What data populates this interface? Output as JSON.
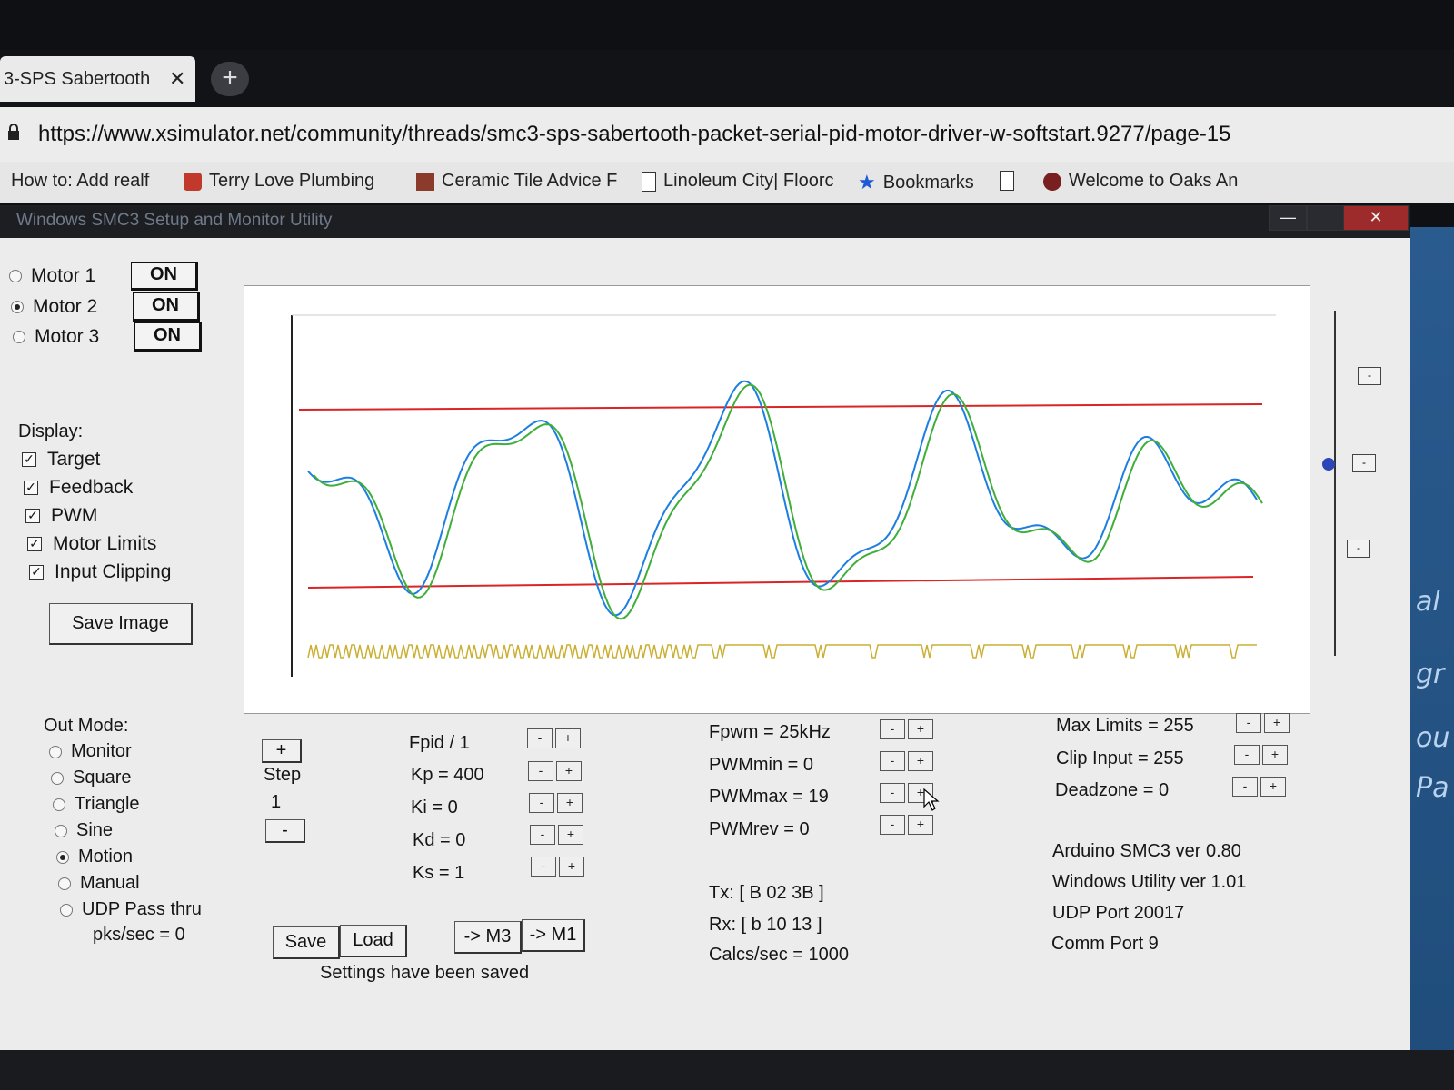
{
  "browser": {
    "tab_title": "3-SPS Sabertooth",
    "tab_close": "✕",
    "new_tab": "+",
    "url": "https://www.xsimulator.net/community/threads/smc3-sps-sabertooth-packet-serial-pid-motor-driver-w-softstart.9277/page-15",
    "bookmarks": [
      "How to: Add realf",
      "Terry Love Plumbing",
      "Ceramic Tile Advice F",
      "Linoleum City| Floorc",
      "Bookmarks",
      "Welcome to Oaks An"
    ]
  },
  "window": {
    "title": "Windows SMC3 Setup and Monitor Utility",
    "minimize": "—",
    "close": "✕"
  },
  "motors": [
    {
      "label": "Motor 1",
      "state": "ON",
      "selected": false
    },
    {
      "label": "Motor 2",
      "state": "ON",
      "selected": true
    },
    {
      "label": "Motor 3",
      "state": "ON",
      "selected": false
    }
  ],
  "display": {
    "heading": "Display:",
    "options": [
      {
        "label": "Target",
        "checked": true
      },
      {
        "label": "Feedback",
        "checked": true
      },
      {
        "label": "PWM",
        "checked": true
      },
      {
        "label": "Motor Limits",
        "checked": true
      },
      {
        "label": "Input Clipping",
        "checked": true
      }
    ],
    "save_image": "Save Image"
  },
  "out_mode": {
    "heading": "Out Mode:",
    "options": [
      {
        "label": "Monitor",
        "selected": false
      },
      {
        "label": "Square",
        "selected": false
      },
      {
        "label": "Triangle",
        "selected": false
      },
      {
        "label": "Sine",
        "selected": false
      },
      {
        "label": "Motion",
        "selected": true
      },
      {
        "label": "Manual",
        "selected": false
      },
      {
        "label": "UDP Pass thru",
        "selected": false
      }
    ],
    "pks": "pks/sec = 0"
  },
  "step": {
    "plus": "+",
    "label": "Step",
    "value": "1",
    "minus": "-"
  },
  "pid": {
    "fpid": "Fpid / 1",
    "kp": "Kp = 400",
    "ki": "Ki = 0",
    "kd": "Kd = 0",
    "ks": "Ks = 1"
  },
  "pwm": {
    "fpwm": "Fpwm = 25kHz",
    "pwmmin": "PWMmin = 0",
    "pwmmax": "PWMmax = 19",
    "pwmrev": "PWMrev = 0"
  },
  "limits": {
    "max": "Max Limits = 255",
    "clip": "Clip Input = 255",
    "deadzone": "Deadzone = 0"
  },
  "comm": {
    "tx": "Tx: [ B 02 3B ]",
    "rx": "Rx: [ b 10 13 ]",
    "calcs": "Calcs/sec = 1000"
  },
  "info": {
    "arduino": "Arduino SMC3 ver 0.80",
    "windows": "Windows Utility ver 1.01",
    "udp": "UDP Port 20017",
    "comport": "Comm Port 9"
  },
  "buttons": {
    "save": "Save",
    "load": "Load",
    "to_m3": "-> M3",
    "to_m1": "-> M1",
    "status": "Settings have been saved"
  },
  "bg_right_text": [
    "al",
    "gr",
    "ou",
    "Pa"
  ],
  "pm": {
    "minus": "-",
    "plus": "+"
  },
  "colors": {
    "target": "#1c7ee0",
    "feedback": "#3fae3a",
    "limits": "#d92525",
    "pwm": "#c9b035"
  }
}
